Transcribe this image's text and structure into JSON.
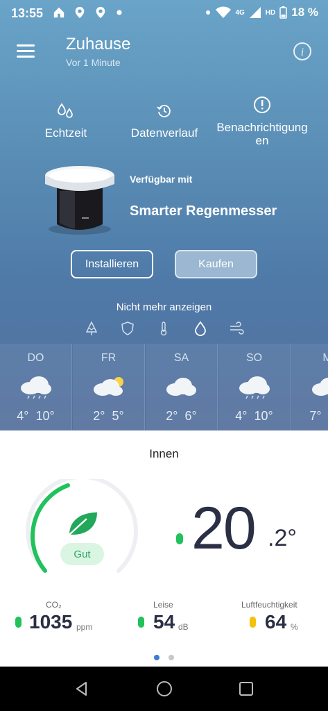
{
  "status_bar": {
    "time": "13:55",
    "network": "4G",
    "hd": "HD",
    "battery": "18 %"
  },
  "header": {
    "title": "Zuhause",
    "subtitle": "Vor 1 Minute"
  },
  "tabs": [
    {
      "label": "Echtzeit",
      "icon": "drops-icon"
    },
    {
      "label": "Datenverlauf",
      "icon": "history-icon"
    },
    {
      "label": "Benachrichtigungen",
      "icon": "alert-icon"
    }
  ],
  "promo": {
    "available": "Verfügbar mit",
    "product": "Smarter Regenmesser",
    "install_label": "Installieren",
    "buy_label": "Kaufen",
    "dismiss_label": "Nicht mehr anzeigen"
  },
  "module_icons": [
    "tree-icon",
    "shield-icon",
    "thermometer-icon",
    "drop-icon",
    "wind-icon"
  ],
  "forecast": [
    {
      "day": "DO",
      "low": "4°",
      "high": "10°",
      "icon": "rain-cloud-icon"
    },
    {
      "day": "FR",
      "low": "2°",
      "high": "5°",
      "icon": "partly-sunny-icon"
    },
    {
      "day": "SA",
      "low": "2°",
      "high": "6°",
      "icon": "cloud-icon"
    },
    {
      "day": "SO",
      "low": "4°",
      "high": "10°",
      "icon": "rain-cloud-icon"
    },
    {
      "day": "M",
      "low": "7°",
      "high": "",
      "icon": "cloud-icon"
    }
  ],
  "indoor": {
    "heading": "Innen",
    "quality_label": "Gut",
    "temp_int": "20",
    "temp_dec": ".2°",
    "metrics": [
      {
        "label": "CO₂",
        "value": "1035",
        "unit": "ppm",
        "color": "#21c25c"
      },
      {
        "label": "Leise",
        "value": "54",
        "unit": "dB",
        "color": "#21c25c"
      },
      {
        "label": "Luftfeuchtigkeit",
        "value": "64",
        "unit": "%",
        "color": "#f4c20d"
      }
    ],
    "pages": 2,
    "current_page": 1
  },
  "colors": {
    "accent_green": "#21c25c",
    "pager_active": "#3a7bd5",
    "dark_text": "#2b2f45"
  }
}
